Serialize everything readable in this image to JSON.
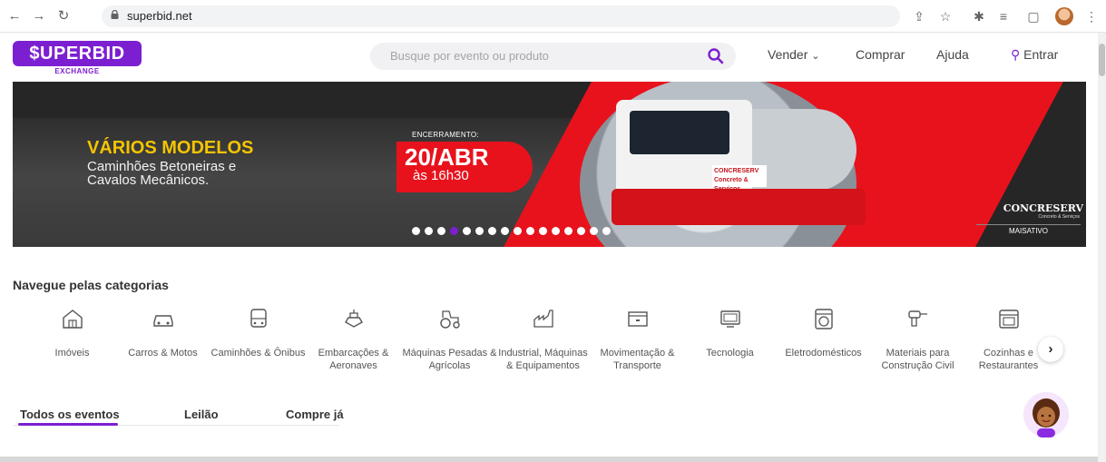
{
  "browser": {
    "url": "superbid.net",
    "icons": [
      "back-arrow-icon",
      "forward-arrow-icon",
      "reload-icon",
      "lock-icon",
      "share-icon",
      "star-icon",
      "extensions-icon",
      "media-icon",
      "side-panel-icon",
      "profile-avatar",
      "more-vert-icon"
    ]
  },
  "header": {
    "logo_text": "$UPERBID",
    "logo_sub": "EXCHANGE",
    "search_placeholder": "Busque por evento ou produto",
    "menu": {
      "vender": "Vender",
      "comprar": "Comprar",
      "ajuda": "Ajuda",
      "entrar": "Entrar"
    }
  },
  "banner": {
    "title": "VÁRIOS MODELOS",
    "subtitle": "Caminhões Betoneiras e Cavalos Mecânicos.",
    "deadline_label": "ENCERRAMENTO:",
    "deadline_date": "20/ABR",
    "deadline_time": "às 16h30",
    "brand": "CONCRESERV",
    "brand_sub": "Concreto & Serviços",
    "brand_tag": "MAISATIVO",
    "door_text": "CONCRESERV Concreto & Serviços",
    "slide_count": 16,
    "active_slide": 4
  },
  "categories": {
    "title": "Navegue pelas categorias",
    "items": [
      {
        "label": "Imóveis",
        "icon": "house-icon"
      },
      {
        "label": "Carros & Motos",
        "icon": "car-icon"
      },
      {
        "label": "Caminhões & Ônibus",
        "icon": "bus-icon"
      },
      {
        "label": "Embarcações & Aeronaves",
        "icon": "ship-icon"
      },
      {
        "label": "Máquinas Pesadas & Agrícolas",
        "icon": "tractor-icon"
      },
      {
        "label": "Industrial, Máquinas & Equipamentos",
        "icon": "factory-icon"
      },
      {
        "label": "Movimentação & Transporte",
        "icon": "container-icon"
      },
      {
        "label": "Tecnologia",
        "icon": "monitor-icon"
      },
      {
        "label": "Eletrodomésticos",
        "icon": "washing-machine-icon"
      },
      {
        "label": "Materiais para Construção Civil",
        "icon": "drill-icon"
      },
      {
        "label": "Cozinhas e Restaurantes",
        "icon": "oven-icon"
      }
    ]
  },
  "tabs": [
    {
      "label": "Todos os eventos",
      "active": true
    },
    {
      "label": "Leilão",
      "active": false
    },
    {
      "label": "Compre já",
      "active": false
    }
  ],
  "colors": {
    "brand": "#7c1fd1",
    "banner_red": "#e8121c",
    "banner_yellow": "#f5c400"
  }
}
